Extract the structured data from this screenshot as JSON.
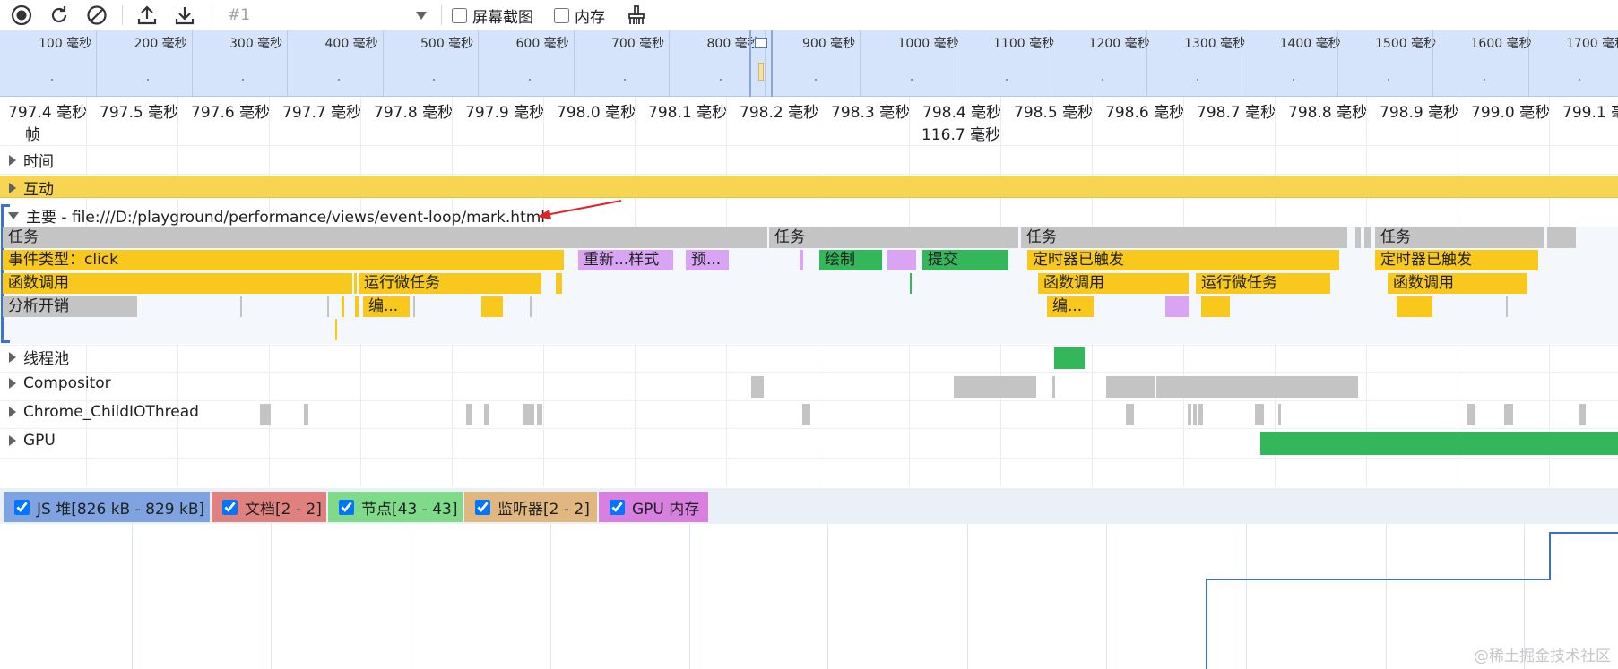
{
  "toolbar": {
    "record_icon": "record-icon",
    "reload_icon": "reload-icon",
    "clear_icon": "clear-icon",
    "upload_icon": "upload-icon",
    "download_icon": "download-icon",
    "profile_select": "#1",
    "screenshots_label": "屏幕截图",
    "memory_label": "内存",
    "broom_icon": "garbage-collect-icon"
  },
  "overview_ticks": [
    "100 毫秒",
    "200 毫秒",
    "300 毫秒",
    "400 毫秒",
    "500 毫秒",
    "600 毫秒",
    "700 毫秒",
    "800 毫秒",
    "900 毫秒",
    "1000 毫秒",
    "1100 毫秒",
    "1200 毫秒",
    "1300 毫秒",
    "1400 毫秒",
    "1500 毫秒",
    "1600 毫秒",
    "1700 毫秒"
  ],
  "ruler_ticks": [
    "797.4 毫秒",
    "797.5 毫秒",
    "797.6 毫秒",
    "797.7 毫秒",
    "797.8 毫秒",
    "797.9 毫秒",
    "798.0 毫秒",
    "798.1 毫秒",
    "798.2 毫秒",
    "798.3 毫秒",
    "798.4 毫秒",
    "798.5 毫秒",
    "798.6 毫秒",
    "798.7 毫秒",
    "798.8 毫秒",
    "798.9 毫秒",
    "799.0 毫秒",
    "799.1 毫秒"
  ],
  "tracks": {
    "frames": "帧",
    "frame_time": "116.7 毫秒",
    "timings": "时间",
    "interactions": "互动",
    "main": "主要 - file:///D:/playground/performance/views/event-loop/mark.html",
    "thread_pool": "线程池",
    "compositor": "Compositor",
    "io_thread": "Chrome_ChildIOThread",
    "gpu": "GPU"
  },
  "main_events": {
    "task_1": "任务",
    "task_2": "任务",
    "task_3": "任务",
    "task_4": "任务",
    "event_click": "事件类型：click",
    "recalc_style": "重新...样式",
    "pre_paint": "预...",
    "paint": "绘制",
    "commit": "提交",
    "timer_fired_1": "定时器已触发",
    "timer_fired_2": "定时器已触发",
    "function_call_1": "函数调用",
    "run_microtasks_1": "运行微任务",
    "function_call_2": "函数调用",
    "run_microtasks_2": "运行微任务",
    "function_call_3": "函数调用",
    "parse_overhead": "分析开销",
    "compile_1": "编...",
    "compile_2": "编..."
  },
  "counters": {
    "js_heap": "JS 堆[826 kB - 829 kB]",
    "documents": "文档[2 - 2]",
    "nodes": "节点[43 - 43]",
    "listeners": "监听器[2 - 2]",
    "gpu_memory": "GPU 内存"
  },
  "colors": {
    "js_heap": "#7fa3e0",
    "documents": "#e0817f",
    "nodes": "#7fdb8a",
    "listeners": "#e0b77f",
    "gpu_memory": "#d97fe0"
  },
  "watermark": "@稀土掘金技术社区"
}
